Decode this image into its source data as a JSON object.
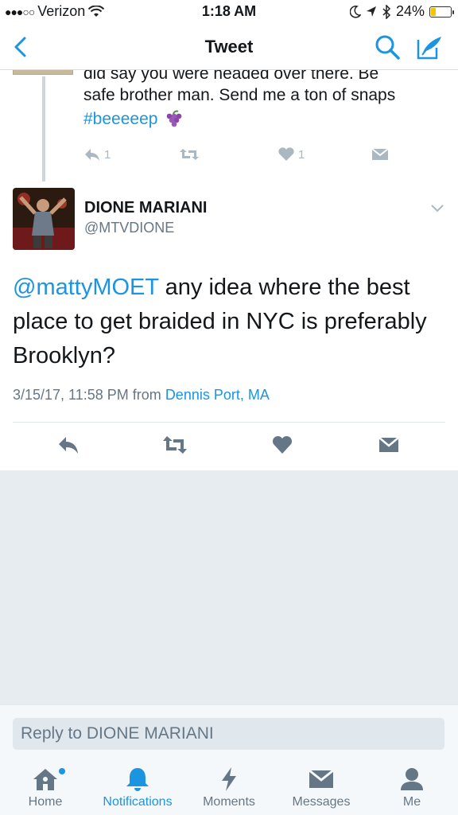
{
  "status_bar": {
    "carrier": "Verizon",
    "time": "1:18 AM",
    "battery": "24%",
    "battery_level": 0.24
  },
  "nav": {
    "title": "Tweet"
  },
  "parent_tweet": {
    "text_line1": "did say you were headed over there. Be",
    "text_line2": "safe brother man. Send me a ton of snaps",
    "hashtag": "#beeeeep",
    "reply_count": "1",
    "like_count": "1"
  },
  "tweet": {
    "name": "DIONE MARIANI",
    "handle": "@MTVDIONE",
    "mention": "@mattyMOET",
    "text": " any idea where the best place to get braided in NYC is preferably Brooklyn?",
    "timestamp": "3/15/17, 11:58 PM",
    "from_label": "from",
    "location": "Dennis Port, MA"
  },
  "reply": {
    "placeholder": "Reply to DIONE MARIANI"
  },
  "tabs": [
    {
      "label": "Home",
      "icon": "home-icon"
    },
    {
      "label": "Notifications",
      "icon": "bell-icon"
    },
    {
      "label": "Moments",
      "icon": "lightning-icon"
    },
    {
      "label": "Messages",
      "icon": "envelope-icon"
    },
    {
      "label": "Me",
      "icon": "person-icon"
    }
  ],
  "colors": {
    "accent": "#1b95e0",
    "icon_gray": "#657786",
    "light_gray": "#aab8c2",
    "background_gray": "#e6ecf0"
  }
}
